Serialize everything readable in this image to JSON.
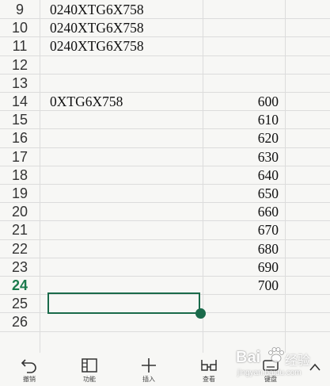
{
  "sheet": {
    "rows": [
      {
        "num": "9",
        "a": "0240XTG6X758",
        "c": ""
      },
      {
        "num": "10",
        "a": "0240XTG6X758",
        "c": ""
      },
      {
        "num": "11",
        "a": "0240XTG6X758",
        "c": ""
      },
      {
        "num": "12",
        "a": "",
        "c": ""
      },
      {
        "num": "13",
        "a": "",
        "c": ""
      },
      {
        "num": "14",
        "a": "0XTG6X758",
        "c": "600"
      },
      {
        "num": "15",
        "a": "",
        "c": "610"
      },
      {
        "num": "16",
        "a": "",
        "c": "620"
      },
      {
        "num": "17",
        "a": "",
        "c": "630"
      },
      {
        "num": "18",
        "a": "",
        "c": "640"
      },
      {
        "num": "19",
        "a": "",
        "c": "650"
      },
      {
        "num": "20",
        "a": "",
        "c": "660"
      },
      {
        "num": "21",
        "a": "",
        "c": "670"
      },
      {
        "num": "22",
        "a": "",
        "c": "680"
      },
      {
        "num": "23",
        "a": "",
        "c": "690"
      },
      {
        "num": "24",
        "a": "",
        "c": "700"
      },
      {
        "num": "25",
        "a": "",
        "c": ""
      },
      {
        "num": "26",
        "a": "",
        "c": ""
      }
    ],
    "active_row": "24",
    "accent_color": "#1a6a4a"
  },
  "toolbar": {
    "undo": {
      "label": "撤销",
      "icon": "undo-icon"
    },
    "function": {
      "label": "功能",
      "icon": "panel-icon"
    },
    "insert": {
      "label": "插入",
      "icon": "plus-icon"
    },
    "view": {
      "label": "查看",
      "icon": "glasses-icon"
    },
    "keyboard": {
      "label": "键盘",
      "icon": "keyboard-icon"
    }
  },
  "watermark": {
    "brand": "Bai",
    "product": "经验",
    "url": "jingyan.baidu.com"
  }
}
